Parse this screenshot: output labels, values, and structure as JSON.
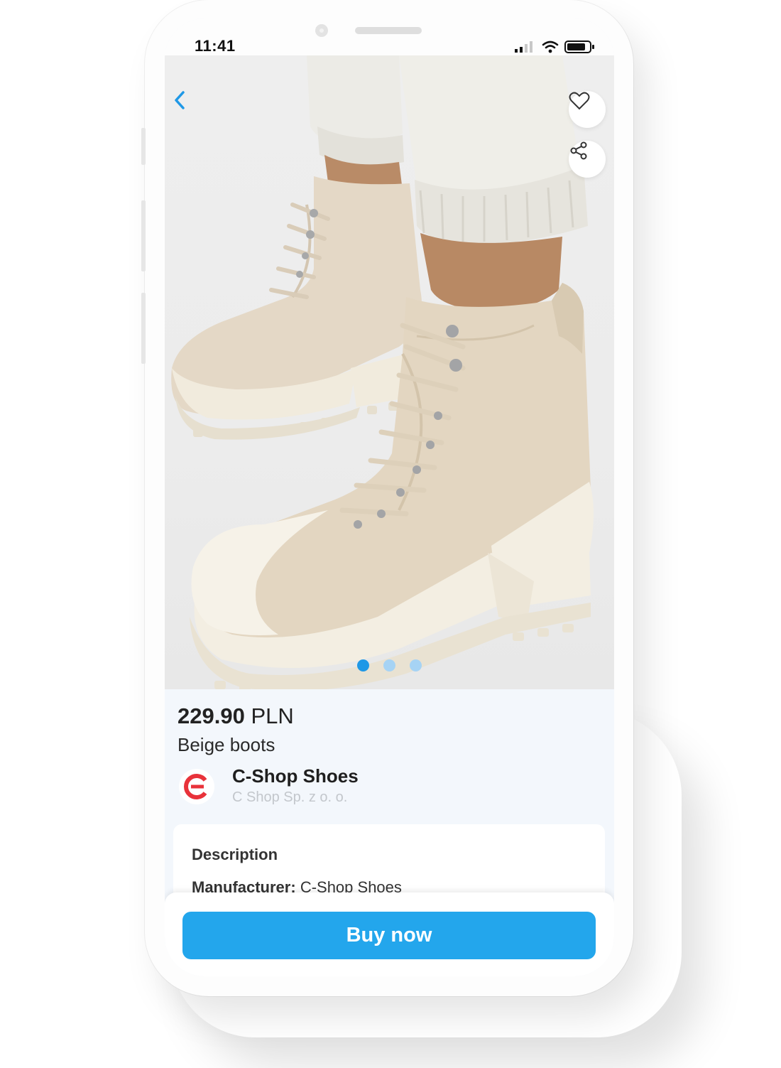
{
  "status_bar": {
    "time": "11:41"
  },
  "product": {
    "price_value": "229.90",
    "currency": "PLN",
    "name": "Beige boots",
    "image_pagination": {
      "total": 3,
      "active_index": 0
    }
  },
  "shop": {
    "name": "C-Shop Shoes",
    "company": "C Shop Sp. z o. o."
  },
  "description": {
    "title": "Description",
    "manufacturer_label": "Manufacturer:",
    "manufacturer_value": "C-Shop Shoes"
  },
  "actions": {
    "buy_label": "Buy now"
  },
  "icons": {
    "back": "chevron-left-icon",
    "favorite": "heart-icon",
    "share": "share-icon",
    "shop_logo": "c-shop-logo"
  },
  "colors": {
    "accent": "#23a6ec",
    "dot_active": "#1f98e6",
    "dot_inactive": "#a6d3f4",
    "logo_red": "#e8323a",
    "background": "#f3f7fc"
  }
}
